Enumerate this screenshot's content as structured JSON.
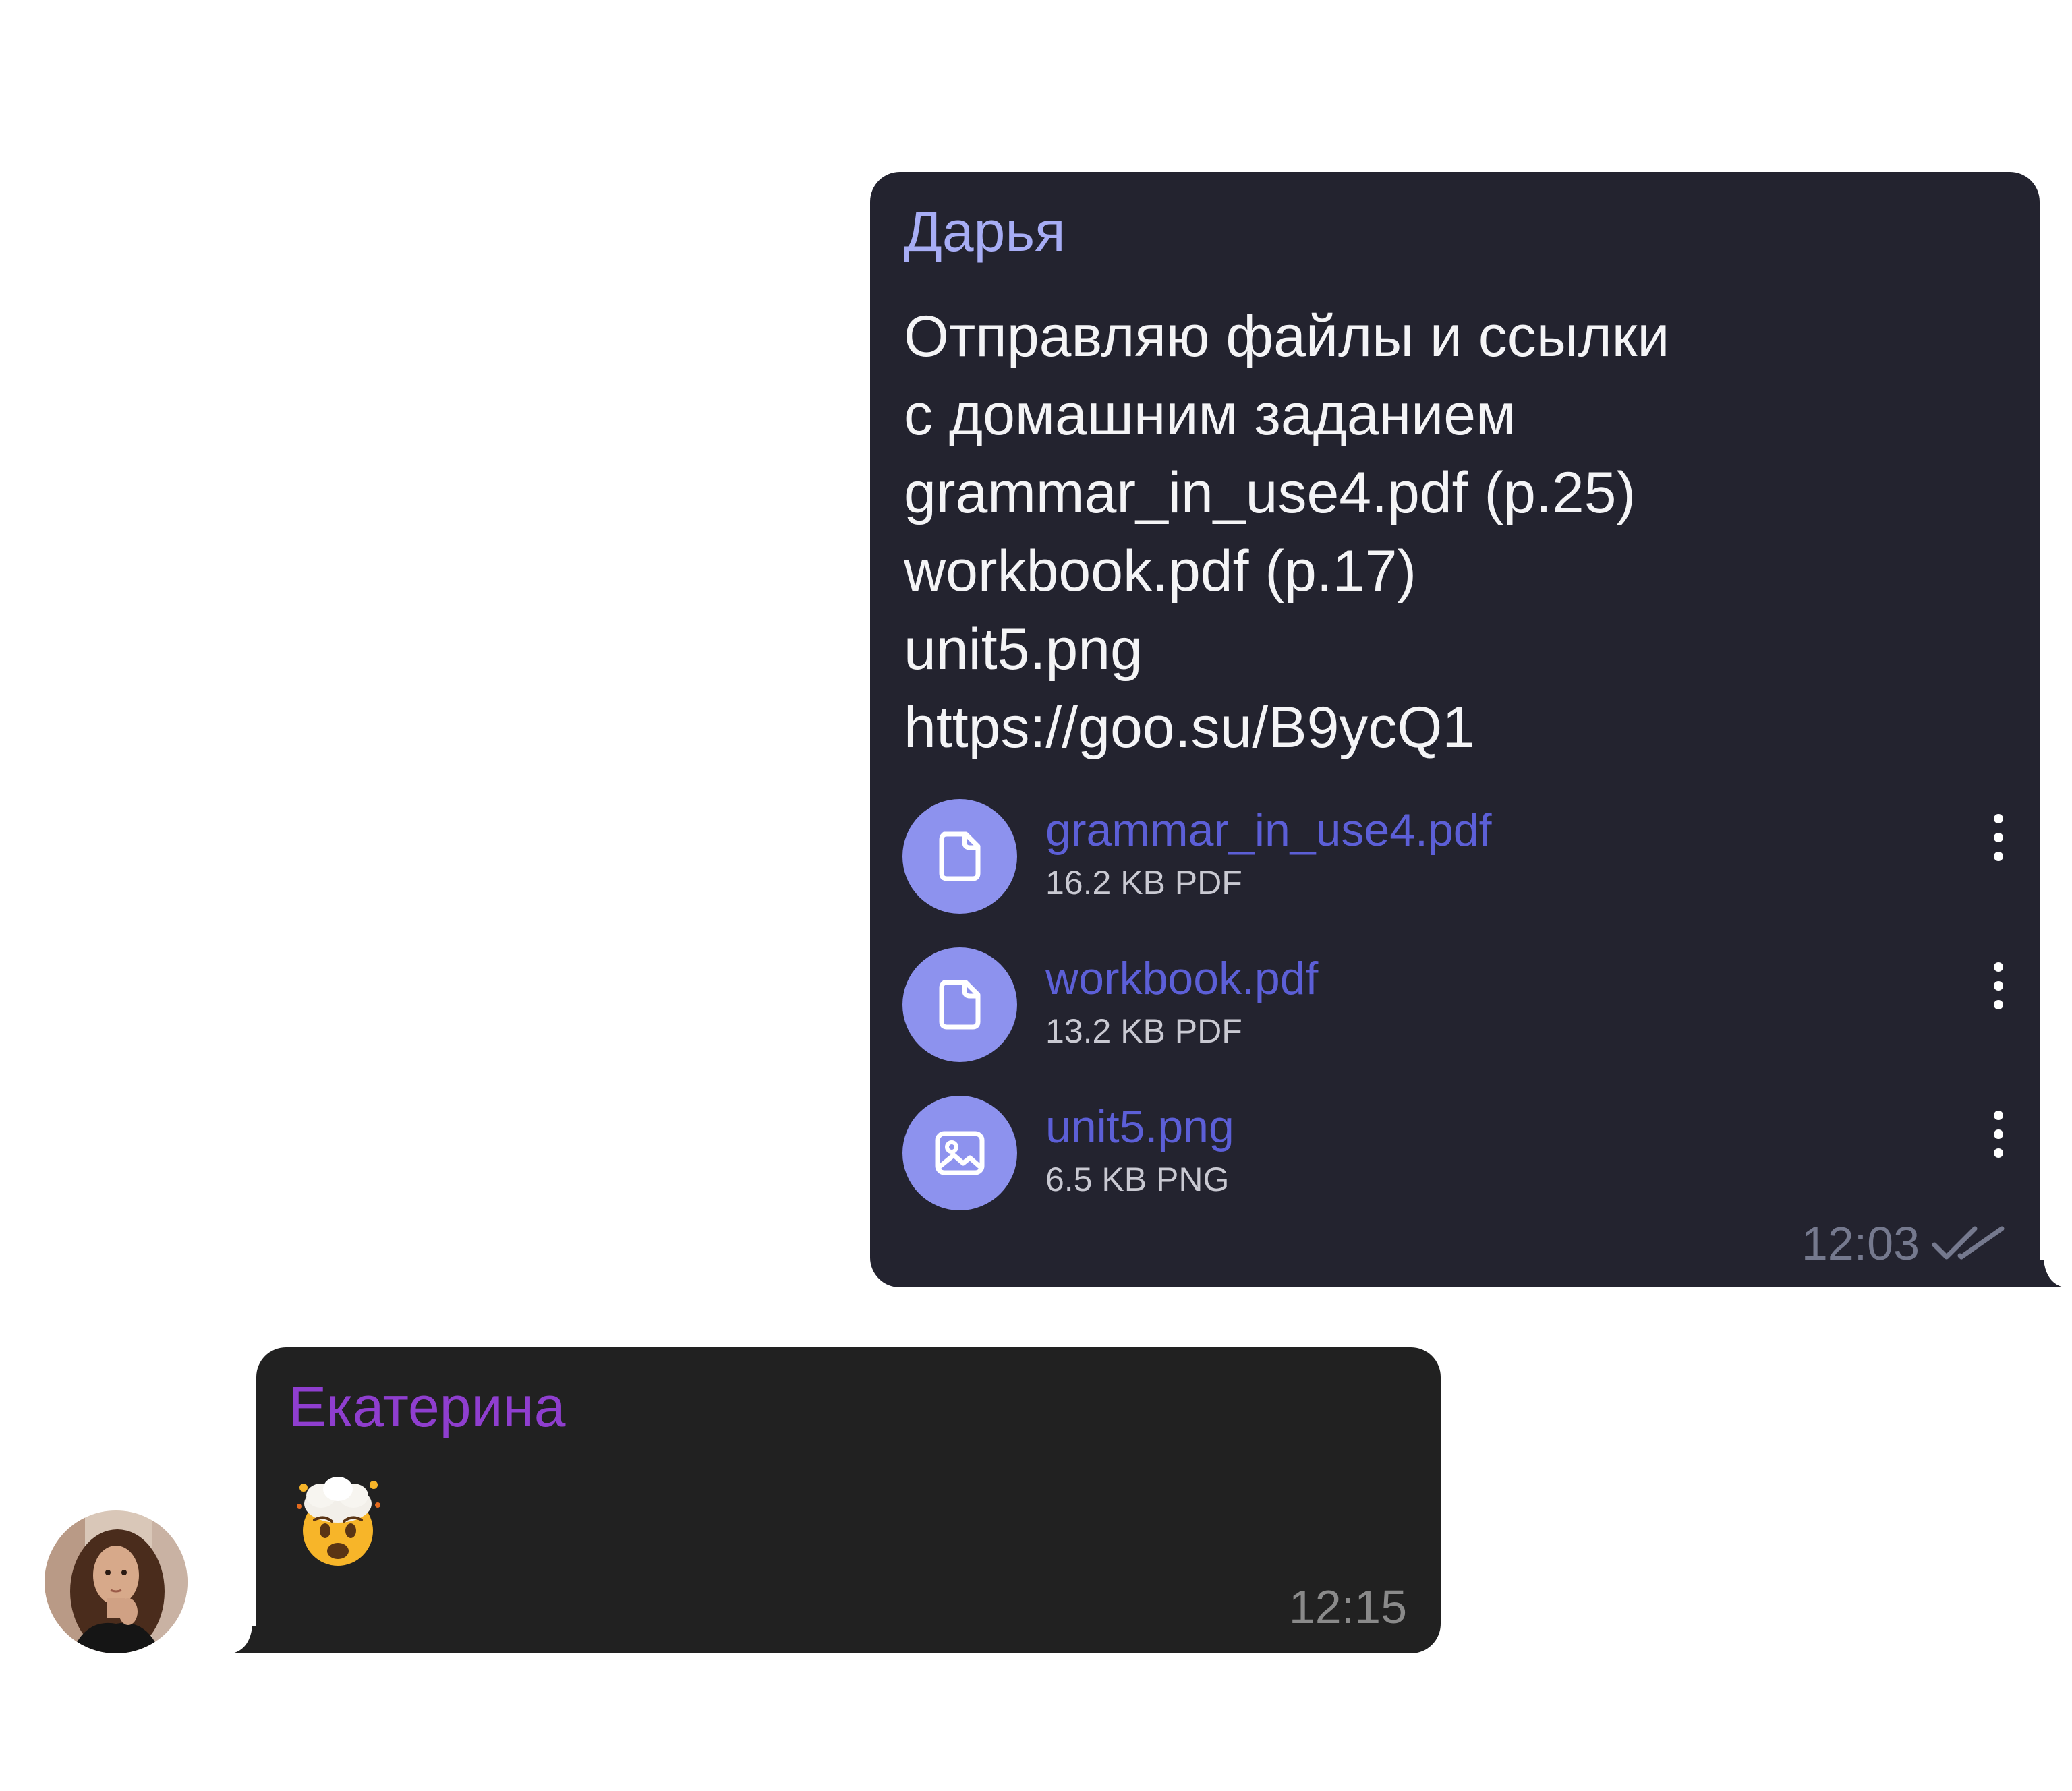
{
  "messages": {
    "outgoing": {
      "sender": "Дарья",
      "text_lines": [
        "Отправляю файлы и ссылки",
        "с домашним заданием",
        "grammar_in_use4.pdf (p.25)",
        "workbook.pdf (p.17)",
        "unit5.png",
        "https://goo.su/B9ycQ1"
      ],
      "attachments": [
        {
          "name": "grammar_in_use4.pdf",
          "meta": "16.2 KB PDF",
          "icon": "document-icon"
        },
        {
          "name": "workbook.pdf",
          "meta": "13.2 KB PDF",
          "icon": "document-icon"
        },
        {
          "name": "unit5.png",
          "meta": "6.5 KB PNG",
          "icon": "image-icon"
        }
      ],
      "time": "12:03",
      "status_icon": "double-check-icon"
    },
    "incoming": {
      "sender": "Екатерина",
      "emoji": "exploding-head-emoji",
      "time": "12:15",
      "avatar": "avatar-photo"
    }
  },
  "colors": {
    "outgoing_bubble": "#23232f",
    "incoming_bubble": "#212121",
    "outgoing_sender": "#a7adf5",
    "incoming_sender": "#8f3ecf",
    "file_link": "#5c5fd7",
    "file_icon_bg": "#8d92ee"
  }
}
